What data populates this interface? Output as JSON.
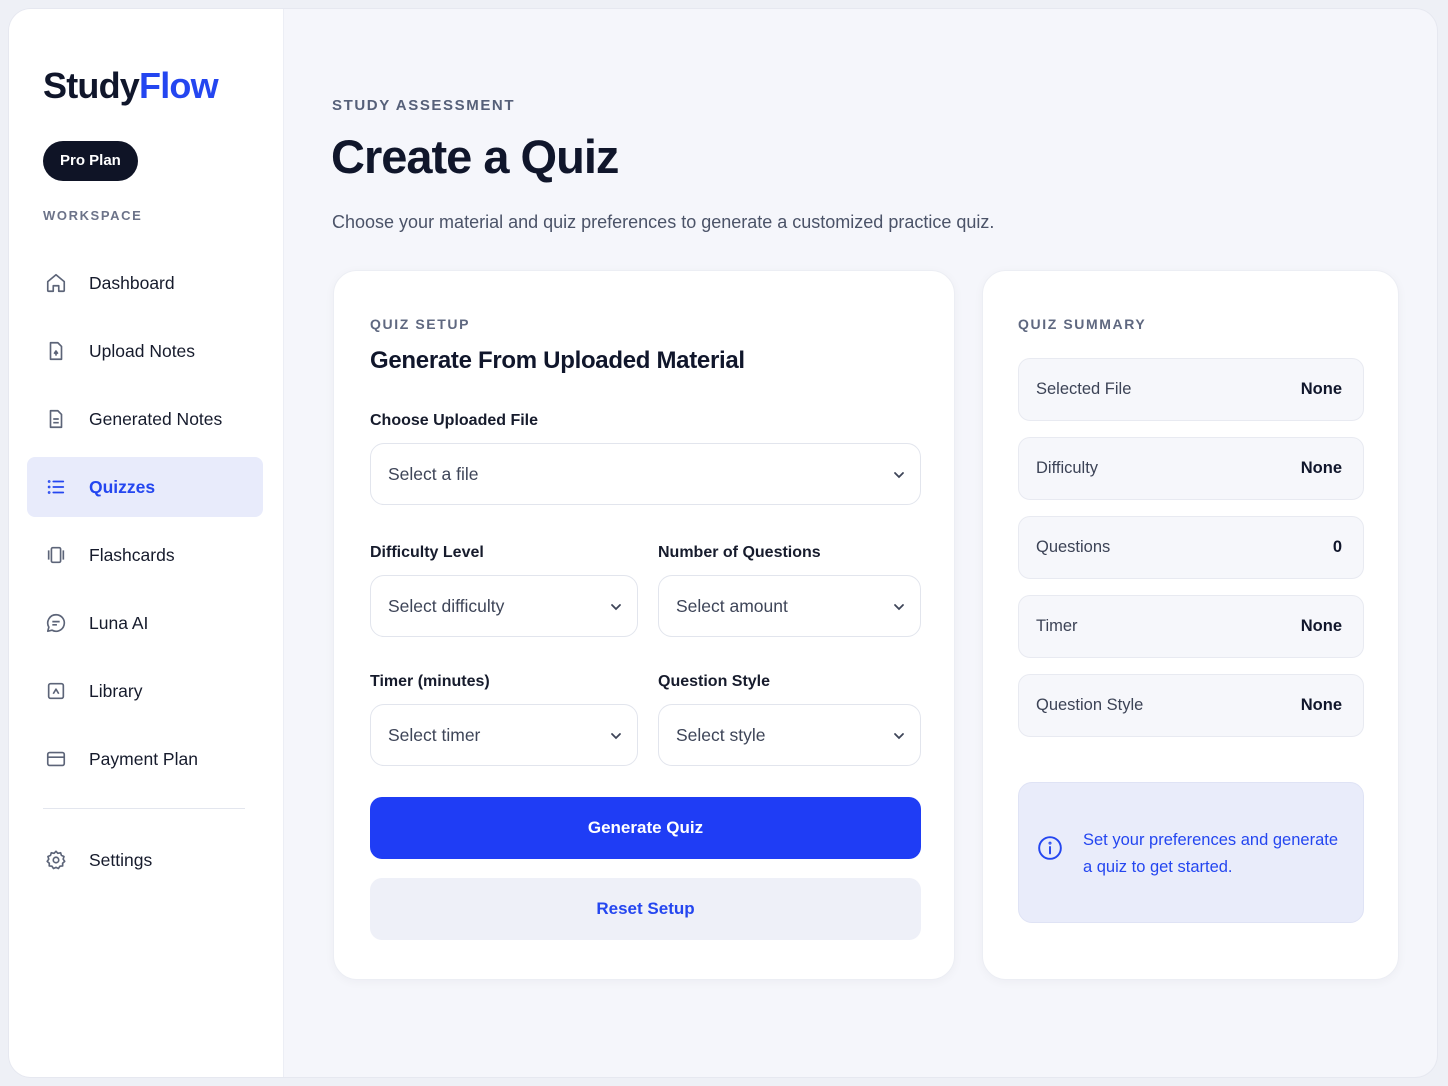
{
  "brand": {
    "name_part1": "Study",
    "name_part2": "Flow",
    "accent_color": "#2446f0"
  },
  "plan_badge": "Pro Plan",
  "sidebar": {
    "section_label": "WORKSPACE",
    "items": [
      {
        "label": "Dashboard",
        "icon": "home-icon",
        "active": false
      },
      {
        "label": "Upload Notes",
        "icon": "upload-file-icon",
        "active": false
      },
      {
        "label": "Generated Notes",
        "icon": "document-icon",
        "active": false
      },
      {
        "label": "Quizzes",
        "icon": "list-icon",
        "active": true
      },
      {
        "label": "Flashcards",
        "icon": "cards-icon",
        "active": false
      },
      {
        "label": "Luna AI",
        "icon": "chat-icon",
        "active": false
      },
      {
        "label": "Library",
        "icon": "library-icon",
        "active": false
      },
      {
        "label": "Payment Plan",
        "icon": "credit-card-icon",
        "active": false
      }
    ],
    "settings": {
      "label": "Settings",
      "icon": "gear-icon"
    }
  },
  "header": {
    "eyebrow": "STUDY ASSESSMENT",
    "title": "Create a Quiz",
    "subtitle": "Choose your material and quiz preferences to generate a customized practice quiz."
  },
  "setup": {
    "eyebrow": "QUIZ SETUP",
    "title": "Generate From Uploaded Material",
    "file": {
      "label": "Choose Uploaded File",
      "value": "Select a file"
    },
    "difficulty": {
      "label": "Difficulty Level",
      "value": "Select difficulty"
    },
    "questions": {
      "label": "Number of Questions",
      "value": "Select amount"
    },
    "timer": {
      "label": "Timer (minutes)",
      "value": "Select timer"
    },
    "style": {
      "label": "Question Style",
      "value": "Select style"
    },
    "generate_label": "Generate Quiz",
    "reset_label": "Reset Setup"
  },
  "summary": {
    "eyebrow": "QUIZ SUMMARY",
    "rows": [
      {
        "key": "Selected File",
        "value": "None"
      },
      {
        "key": "Difficulty",
        "value": "None"
      },
      {
        "key": "Questions",
        "value": "0"
      },
      {
        "key": "Timer",
        "value": "None"
      },
      {
        "key": "Question Style",
        "value": "None"
      }
    ],
    "info_text": "Set your preferences and generate a quiz to get started.",
    "info_icon": "info-icon"
  }
}
